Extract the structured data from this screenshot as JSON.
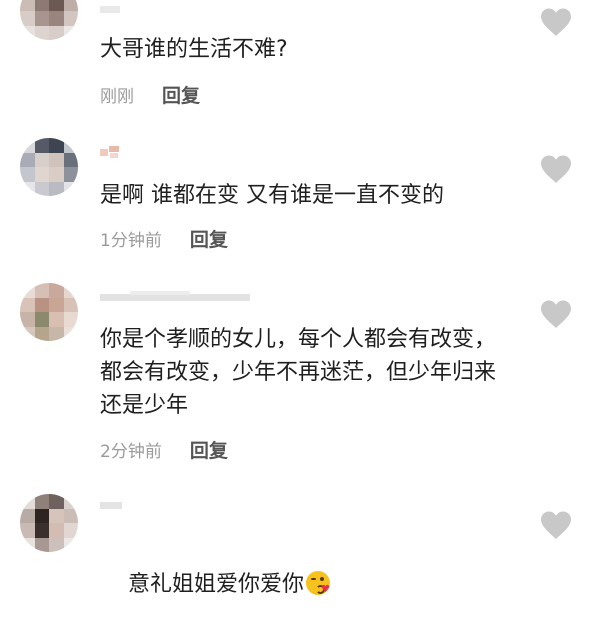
{
  "colors": {
    "text": "#1f1f1f",
    "meta": "#9b9b9b",
    "reply": "#555555",
    "like_icon": "#c8c8c8",
    "background": "#ffffff"
  },
  "comments": [
    {
      "text": "大哥谁的生活不难?",
      "time": "刚刚",
      "reply_label": "回复",
      "like_icon": "heart-icon"
    },
    {
      "text": "是啊 谁都在变 又有谁是一直不变的",
      "time": "1分钟前",
      "reply_label": "回复",
      "like_icon": "heart-icon"
    },
    {
      "text": "你是个孝顺的女儿，每个人都会有改变，都会有改变，少年不再迷茫，但少年归来还是少年",
      "time": "2分钟前",
      "reply_label": "回复",
      "like_icon": "heart-icon"
    },
    {
      "text": "意礼姐姐爱你爱你",
      "emoji": "kissing-face-emoji",
      "like_icon": "heart-icon"
    }
  ]
}
